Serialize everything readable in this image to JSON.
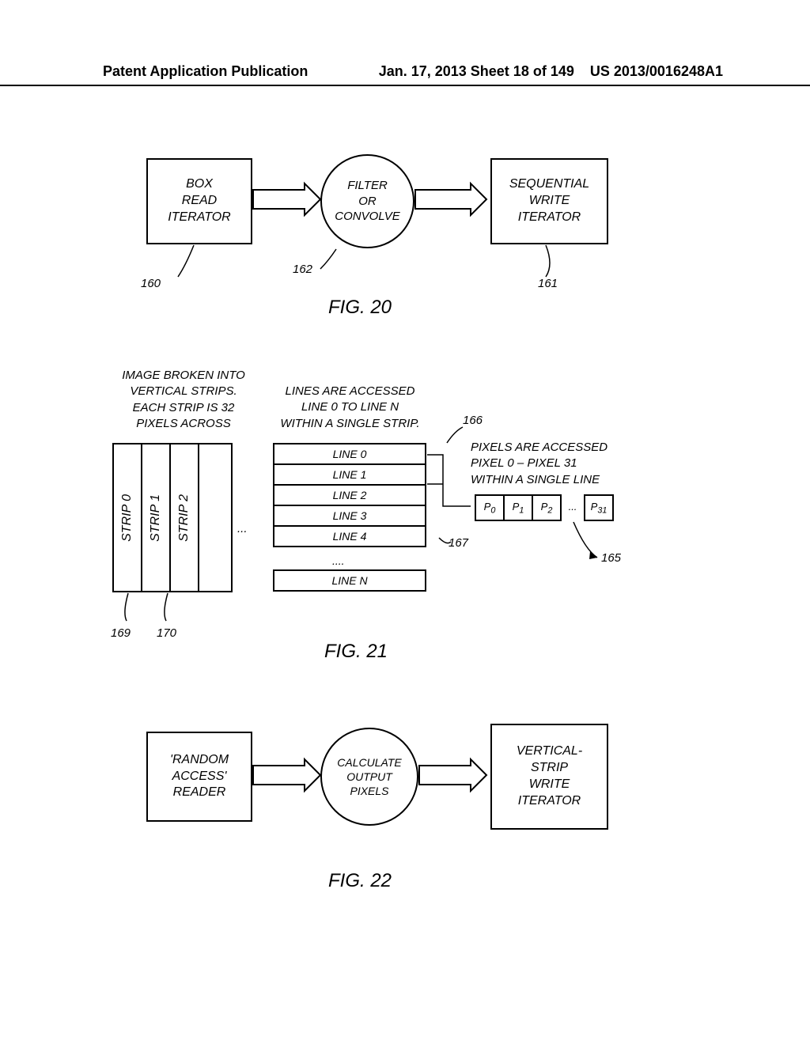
{
  "header": {
    "left": "Patent Application Publication",
    "center": "Jan. 17, 2013  Sheet 18 of 149",
    "right": "US 2013/0016248A1"
  },
  "fig20": {
    "box1": "BOX\nREAD\nITERATOR",
    "circle": "FILTER\nOR\nCONVOLVE",
    "box2": "SEQUENTIAL\nWRITE\nITERATOR",
    "ref160": "160",
    "ref162": "162",
    "ref161": "161",
    "label": "FIG. 20"
  },
  "fig21": {
    "caption_left": "IMAGE BROKEN INTO\nVERTICAL STRIPS.\nEACH STRIP IS 32\nPIXELS ACROSS",
    "caption_mid": "LINES ARE ACCESSED\nLINE 0 TO LINE N\nWITHIN A SINGLE STRIP.",
    "caption_right": "PIXELS ARE ACCESSED\nPIXEL 0 – PIXEL 31\nWITHIN A SINGLE LINE",
    "strips": [
      "STRIP 0",
      "STRIP 1",
      "STRIP 2"
    ],
    "strips_dots": "...",
    "lines": [
      "LINE 0",
      "LINE 1",
      "LINE 2",
      "LINE 3",
      "LINE 4"
    ],
    "lines_dots": "....",
    "line_n": "LINE N",
    "pixels": [
      "P",
      "P",
      "P",
      "...",
      "P"
    ],
    "pixel_subs": [
      "0",
      "1",
      "2",
      "",
      "31"
    ],
    "ref166": "166",
    "ref167": "167",
    "ref165": "165",
    "ref169": "169",
    "ref170": "170",
    "label": "FIG. 21"
  },
  "fig22": {
    "box1": "'RANDOM\nACCESS'\nREADER",
    "circle": "CALCULATE\nOUTPUT\nPIXELS",
    "box2": "VERTICAL-\nSTRIP\nWRITE\nITERATOR",
    "label": "FIG. 22"
  }
}
